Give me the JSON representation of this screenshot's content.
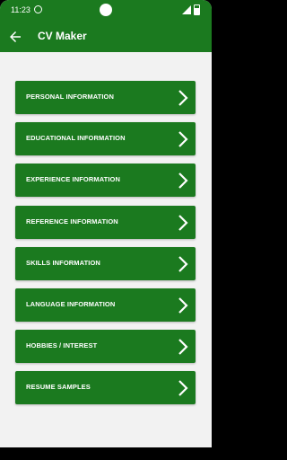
{
  "status_bar": {
    "time": "11:23"
  },
  "app_bar": {
    "title": "CV Maker"
  },
  "menu": {
    "items": [
      {
        "label": "PERSONAL INFORMATION"
      },
      {
        "label": "EDUCATIONAL INFORMATION"
      },
      {
        "label": "EXPERIENCE INFORMATION"
      },
      {
        "label": "REFERENCE INFORMATION"
      },
      {
        "label": "SKILLS INFORMATION"
      },
      {
        "label": "LANGUAGE INFORMATION"
      },
      {
        "label": "HOBBIES / INTEREST"
      },
      {
        "label": "RESUME SAMPLES"
      }
    ]
  },
  "colors": {
    "primary": "#1b7a1f",
    "background": "#f2f2f2"
  },
  "icons": {
    "back": "arrow-left-icon",
    "item_chevron": "chevron-right-icon"
  }
}
